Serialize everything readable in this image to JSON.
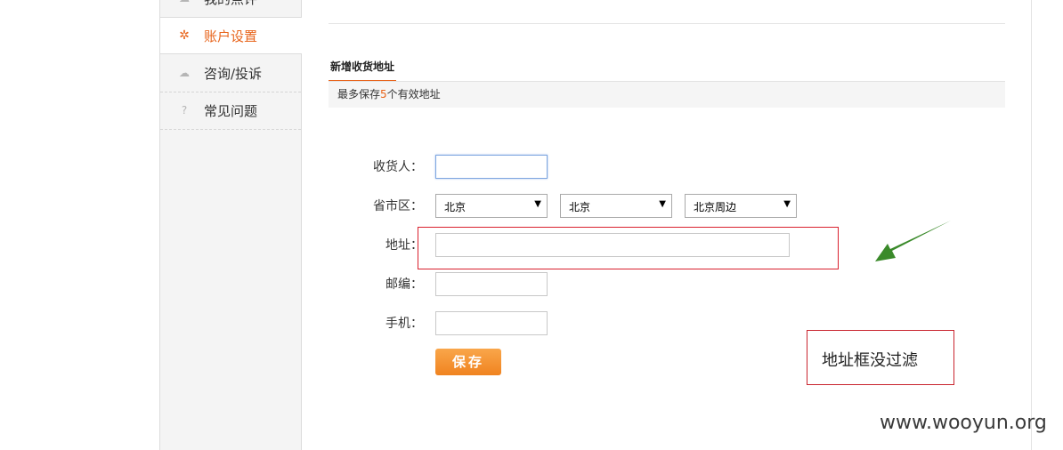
{
  "sidebar": {
    "items": [
      {
        "label": "我的点评",
        "icon": "comment-icon"
      },
      {
        "label": "账户设置",
        "icon": "gear-icon",
        "active": true
      },
      {
        "label": "咨询/投诉",
        "icon": "chat-icon"
      },
      {
        "label": "常见问题",
        "icon": "question-icon"
      }
    ]
  },
  "tab": {
    "title": "新增收货地址"
  },
  "notice": {
    "prefix": "最多保存",
    "count": "5",
    "suffix": "个有效地址"
  },
  "form": {
    "receiver_label": "收货人：",
    "receiver_value": "",
    "region_label": "省市区：",
    "province": "北京",
    "city": "北京",
    "district": "北京周边",
    "address_label": "地址：",
    "address_value": "",
    "zip_label": "邮编：",
    "zip_value": "",
    "phone_label": "手机：",
    "phone_value": "",
    "save_label": "保存"
  },
  "annotation": {
    "text": "地址框没过滤"
  },
  "watermark": "www.wooyun.org",
  "colors": {
    "accent": "#e8641b",
    "highlight": "#d9212e",
    "arrow": "#3a8a2a"
  }
}
